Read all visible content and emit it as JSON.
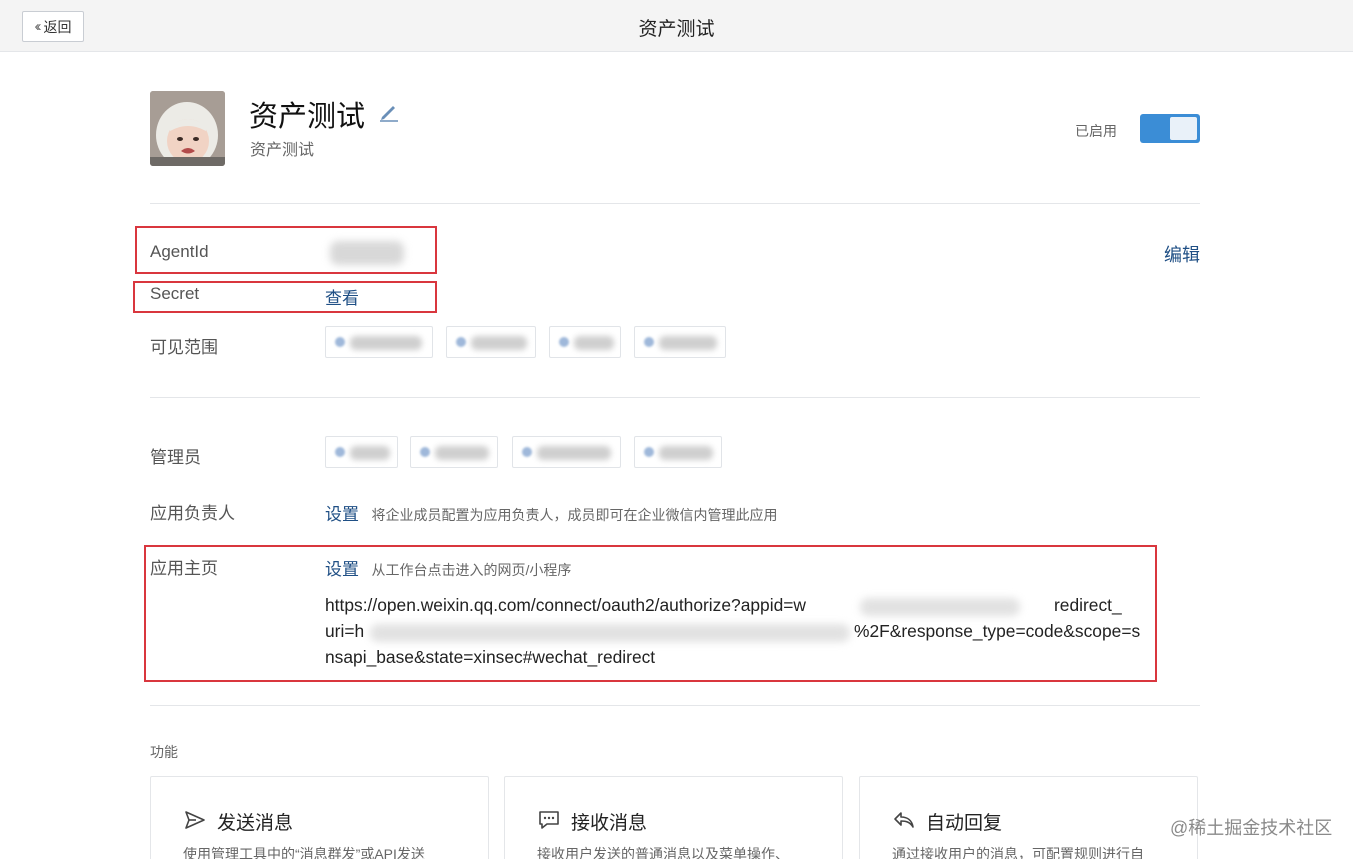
{
  "header": {
    "back_label": "返回",
    "title": "资产测试"
  },
  "app": {
    "name": "资产测试",
    "description": "资产测试",
    "status_label": "已启用",
    "enabled": true
  },
  "fields": {
    "agentid_label": "AgentId",
    "edit_link": "编辑",
    "secret_label": "Secret",
    "secret_view_link": "查看",
    "visibility_label": "可见范围"
  },
  "admins": {
    "label": "管理员"
  },
  "owner": {
    "label": "应用负责人",
    "set_link": "设置",
    "hint": "将企业成员配置为应用负责人，成员即可在企业微信内管理此应用"
  },
  "homepage": {
    "label": "应用主页",
    "set_link": "设置",
    "hint": "从工作台点击进入的网页/小程序",
    "url_line1": "https://open.weixin.qq.com/connect/oauth2/authorize?appid=w",
    "url_line1_end": "redirect_",
    "url_line2_start": "uri=h",
    "url_line2_end": "%2F&response_type=code&scope=s",
    "url_line3": "nsapi_base&state=xinsec#wechat_redirect"
  },
  "features": {
    "section_title": "功能",
    "cards": [
      {
        "title": "发送消息",
        "desc": "使用管理工具中的“消息群发”或API发送",
        "icon": "send-icon"
      },
      {
        "title": "接收消息",
        "desc": "接收用户发送的普通消息以及菜单操作、",
        "icon": "message-icon"
      },
      {
        "title": "自动回复",
        "desc": "通过接收用户的消息，可配置规则进行自",
        "icon": "reply-icon"
      }
    ]
  },
  "watermark": "@稀土掘金技术社区",
  "colors": {
    "accent": "#3b8dd6",
    "link": "#2b6cb0",
    "highlight_box": "#d9363e"
  }
}
